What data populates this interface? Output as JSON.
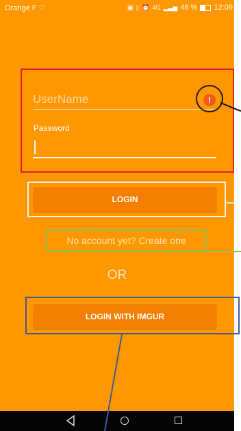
{
  "status_bar": {
    "carrier": "Orange F",
    "battery": "46 %",
    "time": "12:09",
    "network": "4G"
  },
  "form": {
    "username_value": "UserName",
    "password_label": "Password"
  },
  "buttons": {
    "login": "LOGIN",
    "imgur": "LOGIN WITH IMGUR"
  },
  "links": {
    "create_account": "No account yet? Create one"
  },
  "separator": "OR",
  "icons": {
    "error": "error-icon",
    "back": "back-icon",
    "home": "home-icon",
    "recents": "recents-icon"
  },
  "colors": {
    "background": "#FF9800",
    "button": "#F47E00",
    "error": "#F05A1A",
    "annotation_red": "#E52020",
    "annotation_white": "#F4F4F4",
    "annotation_green": "#8BC34A",
    "annotation_blue": "#3F5B96"
  }
}
